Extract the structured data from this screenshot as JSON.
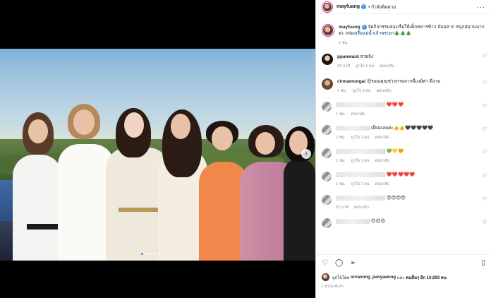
{
  "header": {
    "username": "mayfuang",
    "follow_status": "• กำลังติดตาม",
    "more_icon": "more-horizontal-icon"
  },
  "caption": {
    "username": "mayfuang",
    "text": "จัดกิจกรรมล่องเรือให้เด็กทหารข้าว จับฉลาก สนุกสนานมากค่ะ",
    "hashtag": "#ล่องเรือแม่น้ำเจ้าพระยา",
    "emoji": "🎄🎄🎄",
    "time": "1 ชม."
  },
  "comments": [
    {
      "username": "ppanward",
      "text": "สวยจัง",
      "time": "34 นาที",
      "likes": "ถูกใจ 1 คน",
      "reply": "ตอบกลับ",
      "blurred": false
    },
    {
      "username": "cinnamongal",
      "text": "😍ขอบคุณช่างภาพจากพี่เมย์ค่า ดีงาม",
      "time": "1 ชม.",
      "likes": "ถูกใจ 3 คน",
      "reply": "ตอบกลับ",
      "blurred": false
    },
    {
      "username": "",
      "text": "❤️❤️❤️",
      "time": "1 ชม.",
      "likes": "",
      "reply": "ตอบกลับ",
      "blurred": true
    },
    {
      "username": "",
      "text": "เยี่ยมเลยค่ะ👍👍🖤🖤🖤🖤🖤",
      "time": "1 ชม.",
      "likes": "ถูกใจ 1 คน",
      "reply": "ตอบกลับ",
      "blurred": true
    },
    {
      "username": "",
      "text": "💚💛🧡",
      "time": "1 ชม.",
      "likes": "ถูกใจ 1 คน",
      "reply": "ตอบกลับ",
      "blurred": true
    },
    {
      "username": "",
      "text": "❤️❤️❤️❤️❤️",
      "time": "1 ชม.",
      "likes": "ถูกใจ 1 คน",
      "reply": "ตอบกลับ",
      "blurred": true
    },
    {
      "username": "",
      "text": "😍😍😍😍",
      "time": "57 นาที",
      "likes": "",
      "reply": "ตอบกลับ",
      "blurred": true
    },
    {
      "username": "",
      "text": "😍😍😍",
      "time": "",
      "likes": "",
      "reply": "",
      "blurred": true
    }
  ],
  "footer": {
    "liked_by_prefix": "ถูกใจโดย",
    "liked_by_user": "ornanong_panyawong",
    "liked_by_and": "และ",
    "liked_by_others": "คนอื่นๆ อีก 10,693 คน",
    "post_time": "1 ชั่วโมงที่แล้ว"
  },
  "colors": {
    "verified": "#3897f0",
    "link": "#00376b",
    "meta": "#8e8e8e"
  }
}
